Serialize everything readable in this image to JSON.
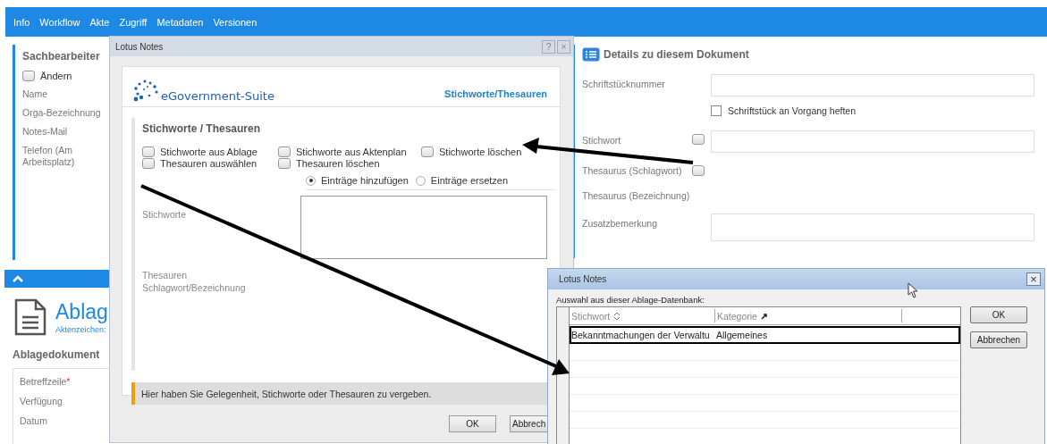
{
  "menu": [
    "Info",
    "Workflow",
    "Akte",
    "Zugriff",
    "Metadaten",
    "Versionen"
  ],
  "left_panel": {
    "title": "Sachbearbeiter",
    "checkbox": {
      "label": "Ändern",
      "checked": false
    },
    "fields": [
      "Name",
      "Orga-Bezeichnung",
      "Notes-Mail",
      "Telefon (Am Arbeitsplatz)"
    ]
  },
  "document": {
    "title": "Ablag",
    "reference_label": "Aktenzeichen:",
    "section_title": "Ablagedokument",
    "fields": [
      {
        "label": "Betreffzeile",
        "mark": "*"
      },
      {
        "label": "Verfügung"
      },
      {
        "label": "Datum"
      }
    ]
  },
  "details": {
    "title": "Details zu diesem Dokument",
    "rows": [
      {
        "kind": "input",
        "label": "Schriftstücknummer"
      },
      {
        "kind": "checkbox",
        "label": "Schriftstück an Vorgang heften",
        "checked": false
      },
      {
        "kind": "checkbox_input",
        "label": "Stichwort",
        "checked": false
      },
      {
        "kind": "checkbox_only",
        "label": "Thesaurus (Schlagwort)",
        "checked": false
      },
      {
        "kind": "text",
        "label": "Thesaurus (Bezeichnung)"
      },
      {
        "kind": "input",
        "label": "Zusatzbemerkung"
      }
    ]
  },
  "dialog": {
    "title": "Lotus Notes",
    "help_button": "?",
    "close_button": "×",
    "brand": "eGovernment-Suite",
    "header_title": "Stichworte/Thesauren",
    "section_title": "Stichworte / Thesauren",
    "options": [
      {
        "label": "Stichworte aus Ablage",
        "checked": false
      },
      {
        "label": "Stichworte aus Aktenplan",
        "checked": false
      },
      {
        "label": "Stichworte löschen",
        "checked": false
      },
      {
        "label": "Thesauren auswählen",
        "checked": false
      },
      {
        "label": "Thesauren löschen",
        "checked": false
      }
    ],
    "modes": [
      {
        "label": "Einträge hinzufügen",
        "selected": true
      },
      {
        "label": "Einträge ersetzen",
        "selected": false
      }
    ],
    "keywords_label": "Stichworte",
    "thesauri_label": "Thesauren Schlagwort/Bezeichnung",
    "hint": "Hier haben Sie Gelegenheit, Stichworte oder Thesauren zu vergeben.",
    "buttons": [
      "OK",
      "Abbrech"
    ]
  },
  "picker": {
    "title": "Lotus Notes",
    "close_button": "×",
    "caption": "Auswahl aus dieser Ablage-Datenbank:",
    "columns": [
      "Stichwort",
      "Kategorie"
    ],
    "rows": [
      {
        "cells": [
          "Bekanntmachungen der Verwaltu",
          "Allgemeines"
        ],
        "selected": true
      }
    ],
    "buttons": [
      "OK",
      "Abbrechen"
    ]
  }
}
